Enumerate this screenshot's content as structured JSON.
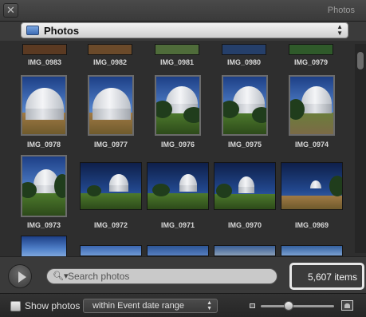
{
  "window": {
    "title": "Photos",
    "close_glyph": "✕"
  },
  "source": {
    "label": "Photos",
    "icon": "photos-library-icon"
  },
  "grid": {
    "top_row": [
      "IMG_0983",
      "IMG_0982",
      "IMG_0981",
      "IMG_0980",
      "IMG_0979"
    ],
    "row2": [
      "IMG_0978",
      "IMG_0977",
      "IMG_0976",
      "IMG_0975",
      "IMG_0974"
    ],
    "row3": [
      "IMG_0973",
      "IMG_0972",
      "IMG_0971",
      "IMG_0970",
      "IMG_0969"
    ]
  },
  "search": {
    "placeholder": "Search photos"
  },
  "count": {
    "label": "5,607 items"
  },
  "footer": {
    "show_label": "Show photos",
    "range_option": "within Event date range",
    "zoom_level": 0.38
  }
}
